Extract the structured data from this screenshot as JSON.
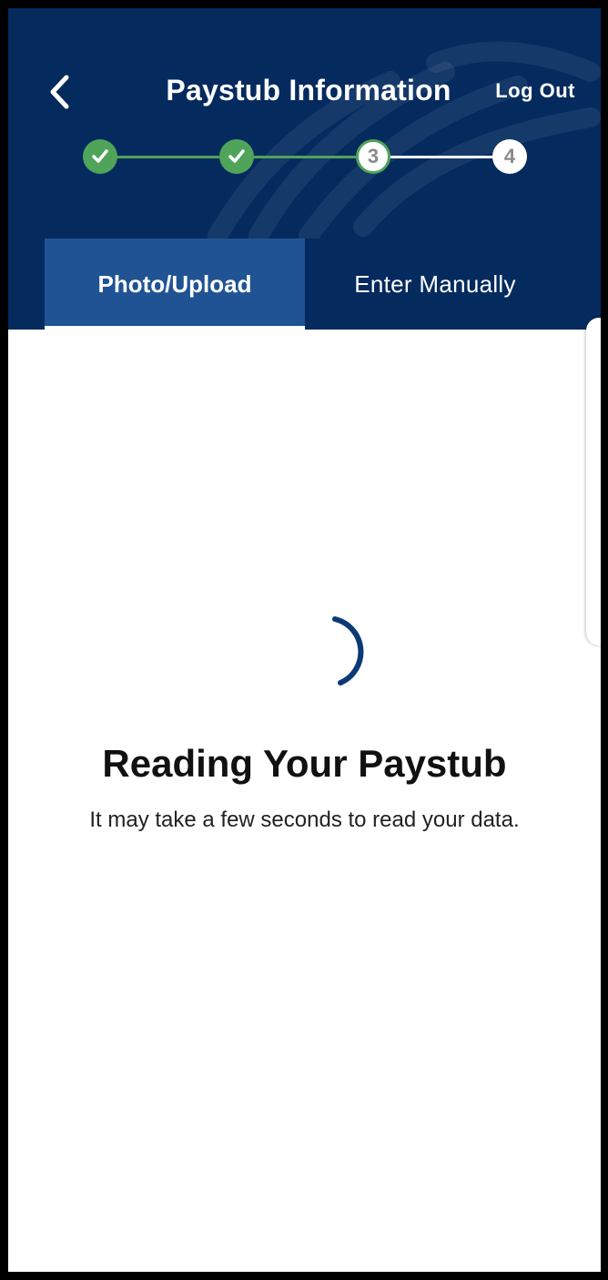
{
  "header": {
    "title": "Paystub Information",
    "logout_label": "Log Out",
    "back_icon": "chevron-left-icon",
    "background": "#042a5e"
  },
  "stepper": {
    "steps": [
      {
        "label": "",
        "state": "complete",
        "icon": "check-icon"
      },
      {
        "label": "",
        "state": "complete",
        "icon": "check-icon"
      },
      {
        "label": "3",
        "state": "current"
      },
      {
        "label": "4",
        "state": "upcoming"
      }
    ],
    "complete_color": "#4fa45a"
  },
  "tabs": [
    {
      "label": "Photo/Upload",
      "active": true
    },
    {
      "label": "Enter Manually",
      "active": false
    }
  ],
  "main": {
    "heading": "Reading Your Paystub",
    "subtext": "It may take a few seconds to read your data.",
    "spinner_color": "#0b3a75"
  }
}
